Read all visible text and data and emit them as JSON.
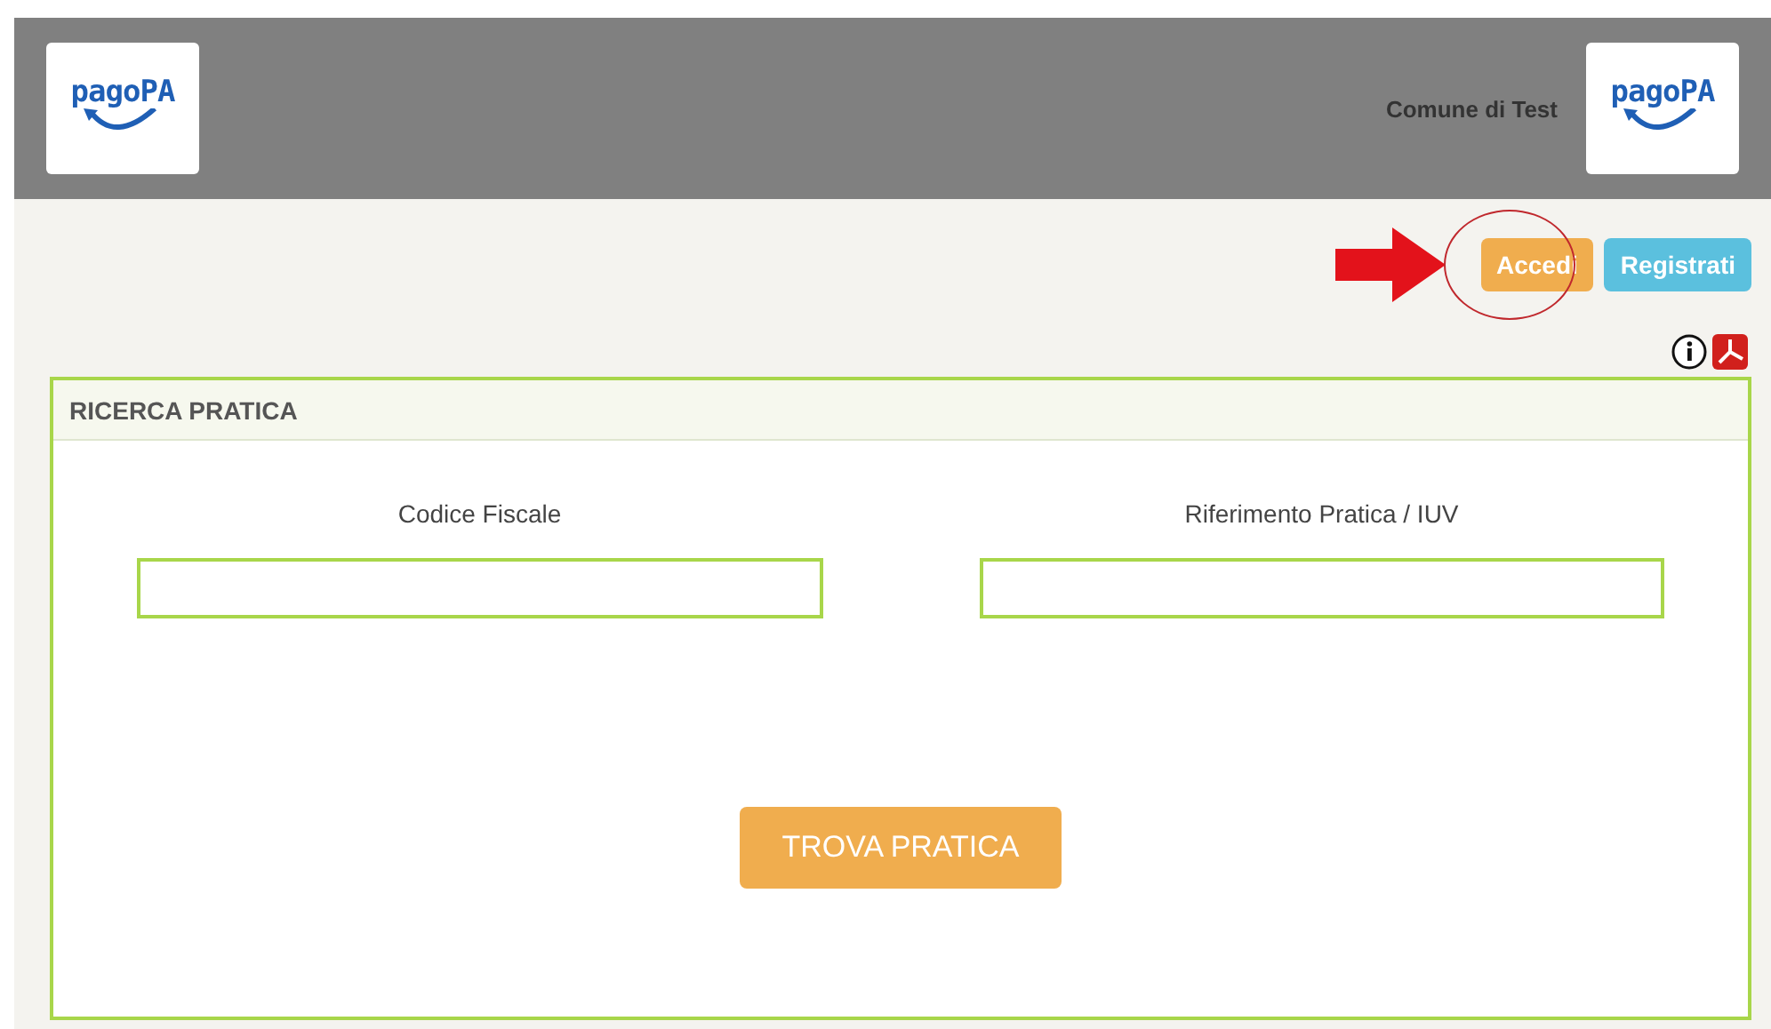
{
  "header": {
    "logo_left": "pagoPA",
    "entity": "Comune di Test",
    "logo_right": "pagoPA"
  },
  "auth_buttons": [
    {
      "label": "Accedi",
      "kind": "primary"
    },
    {
      "label": "Registrati",
      "kind": "info"
    }
  ],
  "panel": {
    "title": "RICERCA PRATICA",
    "fields": [
      {
        "label": "Codice Fiscale"
      },
      {
        "label": "Riferimento Pratica / IUV"
      }
    ],
    "submit": "TROVA PRATICA"
  }
}
